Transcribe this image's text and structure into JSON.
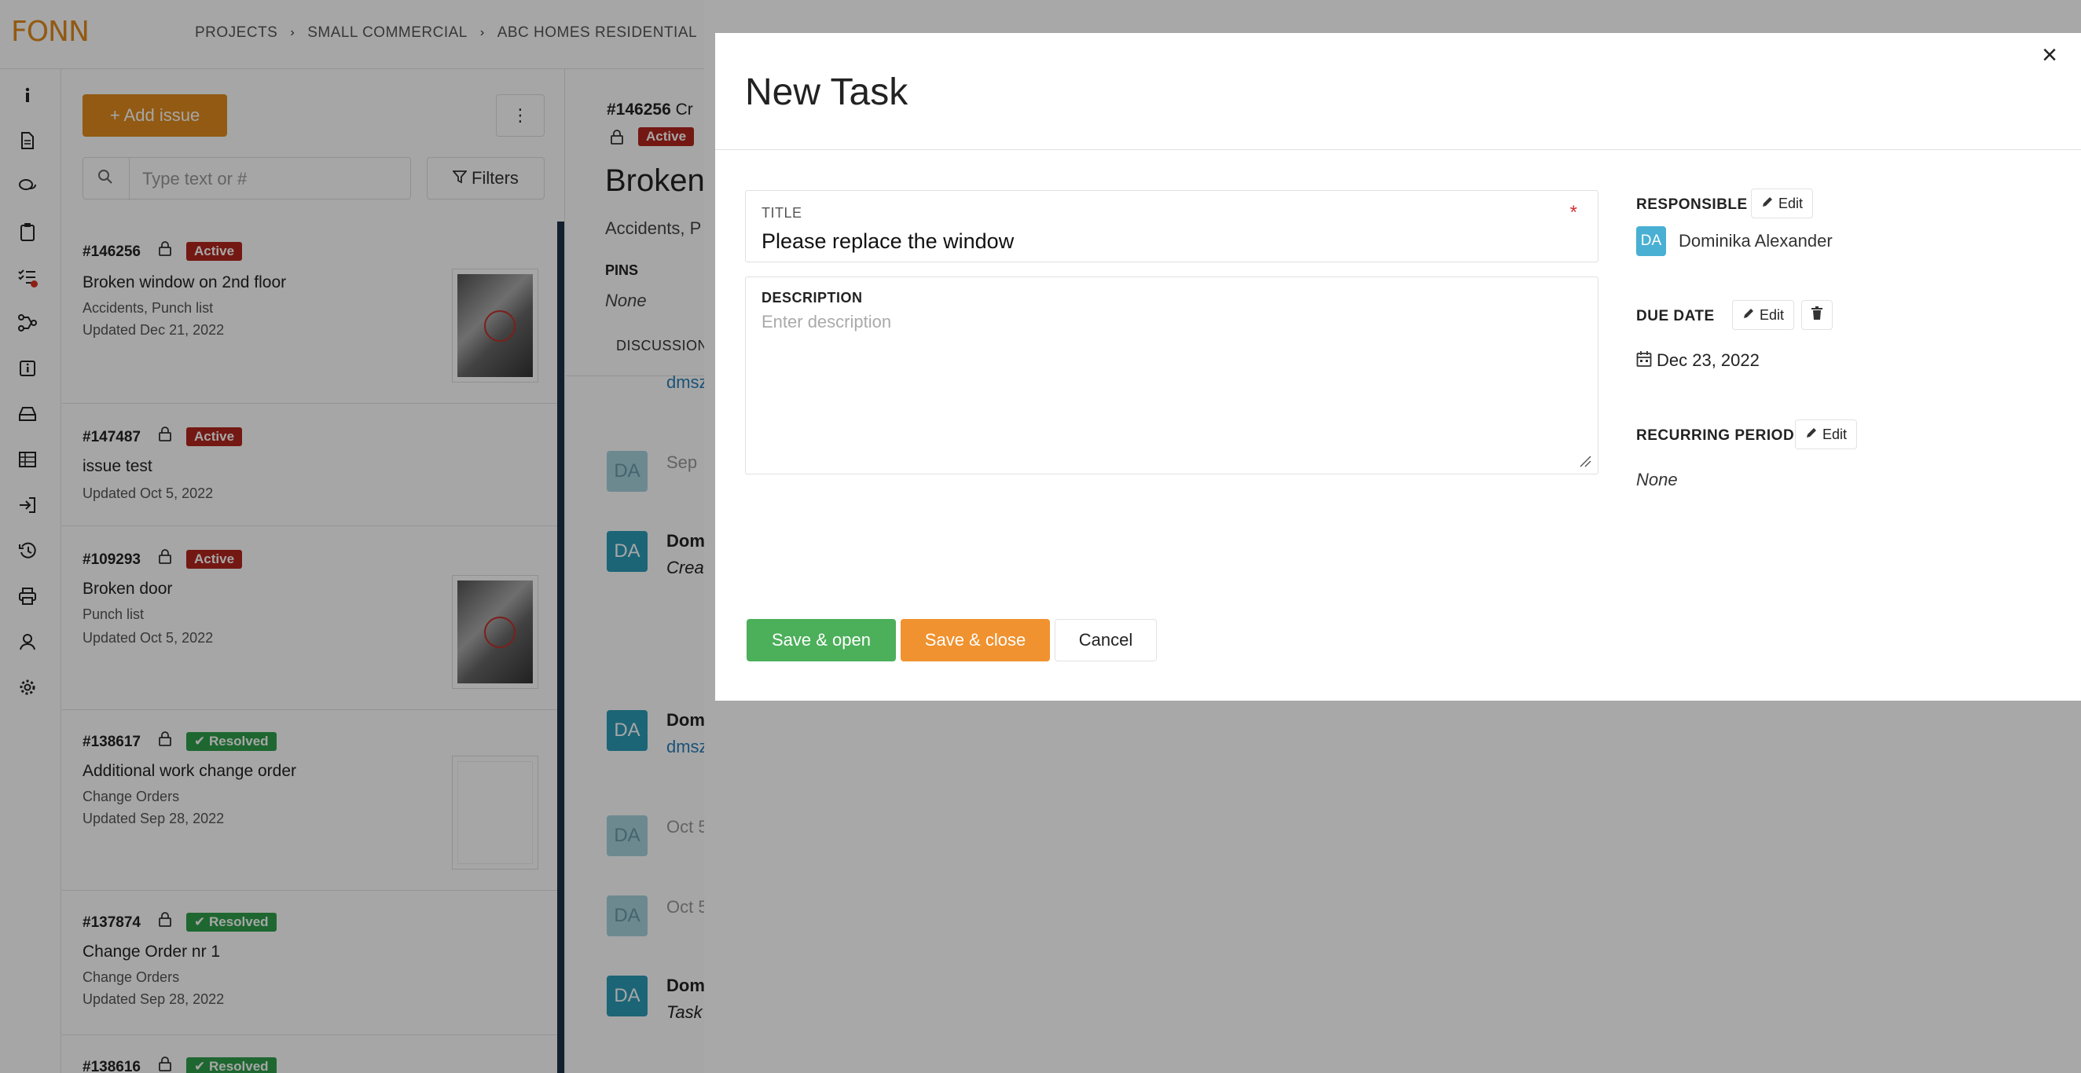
{
  "app": {
    "logo": "FONN",
    "breadcrumb": [
      "PROJECTS",
      "SMALL COMMERCIAL",
      "ABC HOMES RESIDENTIAL"
    ]
  },
  "issues_panel": {
    "add_button": "+ Add issue",
    "kebab": "⋮",
    "search_placeholder": "Type text or #",
    "filters_label": "Filters",
    "items": [
      {
        "num": "#146256",
        "status": "Active",
        "title": "Broken window on 2nd floor",
        "category": "Accidents, Punch list",
        "updated": "Updated Dec 21, 2022"
      },
      {
        "num": "#147487",
        "status": "Active",
        "title": "issue test",
        "category": "",
        "updated": "Updated Oct 5, 2022"
      },
      {
        "num": "#109293",
        "status": "Active",
        "title": "Broken door",
        "category": "Punch list",
        "updated": "Updated Oct 5, 2022"
      },
      {
        "num": "#138617",
        "status": "Resolved",
        "title": "Additional work change order",
        "category": "Change Orders",
        "updated": "Updated Sep 28, 2022"
      },
      {
        "num": "#137874",
        "status": "Resolved",
        "title": "Change Order nr 1",
        "category": "Change Orders",
        "updated": "Updated Sep 28, 2022"
      },
      {
        "num": "#138616",
        "status": "Resolved",
        "title": "",
        "category": "",
        "updated": ""
      }
    ]
  },
  "detail": {
    "num": "#146256",
    "num_suffix": "Cr",
    "status": "Active",
    "title": "Broken",
    "category": "Accidents, P",
    "pins_label": "PINS",
    "pins_value": "None",
    "tab": "DISCUSSION",
    "feed": [
      {
        "avatar": "",
        "text": "dmsz"
      },
      {
        "avatar": "DA",
        "text": "Sep"
      },
      {
        "avatar": "DA",
        "text": "Dom"
      },
      {
        "avatar": "",
        "text": "Crea"
      },
      {
        "avatar": "DA",
        "text": "Dom"
      },
      {
        "avatar": "",
        "text": "dmsz"
      },
      {
        "avatar": "DA",
        "text": "Oct 5"
      },
      {
        "avatar": "DA",
        "text": "Oct 5"
      },
      {
        "avatar": "DA",
        "text": "Dom"
      },
      {
        "avatar": "",
        "text": "Task"
      }
    ]
  },
  "modal": {
    "title": "New Task",
    "close": "×",
    "title_field": {
      "label": "TITLE",
      "required": "*",
      "value": "Please replace the window"
    },
    "description_field": {
      "label": "DESCRIPTION",
      "placeholder": "Enter description"
    },
    "buttons": {
      "save_open": "Save & open",
      "save_close": "Save & close",
      "cancel": "Cancel"
    },
    "responsible": {
      "label": "RESPONSIBLE",
      "edit": "Edit",
      "avatar": "DA",
      "name": "Dominika Alexander"
    },
    "due_date": {
      "label": "DUE DATE",
      "edit": "Edit",
      "value": "Dec 23, 2022"
    },
    "recurring": {
      "label": "RECURRING PERIOD",
      "edit": "Edit",
      "value": "None"
    }
  },
  "colors": {
    "brand": "#e08a1e",
    "active_badge": "#b3261e",
    "resolved_badge": "#2e9e4a",
    "save_open": "#4caf5a",
    "save_close": "#f0922f",
    "avatar": "#49b0d3"
  }
}
